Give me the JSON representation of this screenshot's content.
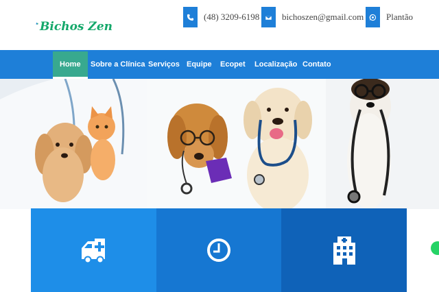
{
  "brand": {
    "name": "Bichos Zen",
    "logo_icon": "dog-cat-logo-icon",
    "accent": "#1e7fd8",
    "logo_color": "#14a86a"
  },
  "contacts": [
    {
      "icon": "phone-icon",
      "text": "(48) 3209-6198"
    },
    {
      "icon": "mail-icon",
      "text": "bichoszen@gmail.com"
    },
    {
      "icon": "whatsapp-icon",
      "text": "Plantão"
    }
  ],
  "nav": {
    "items": [
      {
        "label": "Home",
        "active": true
      },
      {
        "label": "Sobre a Clínica"
      },
      {
        "label": "Serviços"
      },
      {
        "label": "Equipe"
      },
      {
        "label": "Ecopet"
      },
      {
        "label": "Localização"
      },
      {
        "label": "Contato"
      }
    ],
    "active_color": "#38a98f"
  },
  "hero": {
    "image": "veterinary-pets-banner"
  },
  "features": [
    {
      "icon": "ambulance-icon",
      "color": "#1e8ee8"
    },
    {
      "icon": "clock-icon",
      "color": "#1677d2"
    },
    {
      "icon": "hospital-icon",
      "color": "#0f62b8"
    }
  ]
}
